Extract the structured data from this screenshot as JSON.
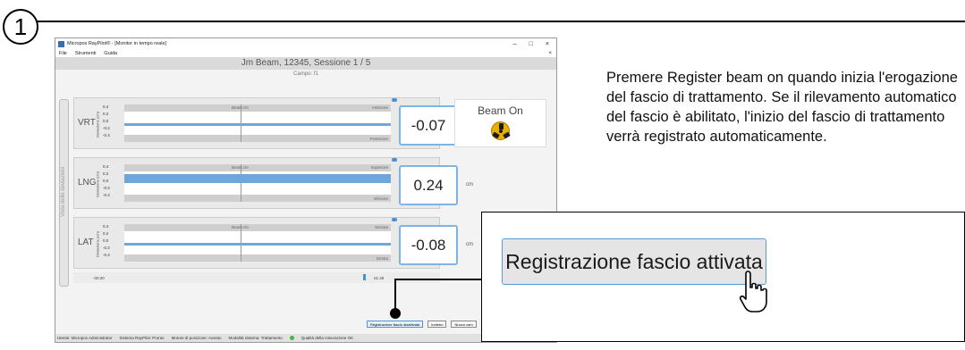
{
  "step_number": "1",
  "instructions": "Premere Register beam on quando inizia l'erogazione del fascio di trattamento. Se il rilevamento automatico del fascio è abilitato, l'inizio del fascio di trattamento verrà registrato automaticamente.",
  "window": {
    "title": "Micropos RayPilot® - [Monitor in tempo reale]",
    "controls": [
      "–",
      "□",
      "×"
    ],
    "menu": [
      "File",
      "Strumenti",
      "Guida"
    ],
    "menu_close": "×"
  },
  "session": {
    "title": "Jm Beam, 12345, Sessione 1 / 5",
    "field": "Campo: f1"
  },
  "vertical_tab": "Vista delle deviazioni",
  "y_axis_label": "Deviazione (cm)",
  "ticks": [
    "0.4",
    "0.2",
    "0.0",
    "-0.2",
    "-0.4"
  ],
  "unit": "cm",
  "rows": [
    {
      "label": "VRT",
      "value": "-0.07",
      "beam_label": "Beam On",
      "top_label": "Anteriore",
      "bottom_label": "Posteriore",
      "level": -0.07
    },
    {
      "label": "LNG",
      "value": "0.24",
      "beam_label": "Beam On",
      "top_label": "Superiore",
      "bottom_label": "Inferiore",
      "level": 0.24
    },
    {
      "label": "LAT",
      "value": "-0.08",
      "beam_label": "Beam On",
      "top_label": "Sinistra",
      "bottom_label": "Destra",
      "level": -0.08
    }
  ],
  "beam_status": {
    "label": "Beam On",
    "icon": "radiation-icon"
  },
  "timeline": {
    "start": "-00:30",
    "end": "01:48"
  },
  "buttons": [
    "Registrazione fascio disattivata",
    "Indietro",
    "Nuovo cam"
  ],
  "status_bar": {
    "user": "Utente: Micropos Administrator",
    "system": "Sistema RayPilot: Pronto",
    "motor": "Motore di posizione: Avviato",
    "mode": "Modalità sistema: Trattamento",
    "quality": "Qualità della misurazione OK"
  },
  "zoom_button": "Registrazione fascio attivata",
  "colors": {
    "accent": "#5b9bd5",
    "signal": "#6ea7db",
    "status_ok": "#4caf50",
    "radiation": "#e7b000"
  }
}
